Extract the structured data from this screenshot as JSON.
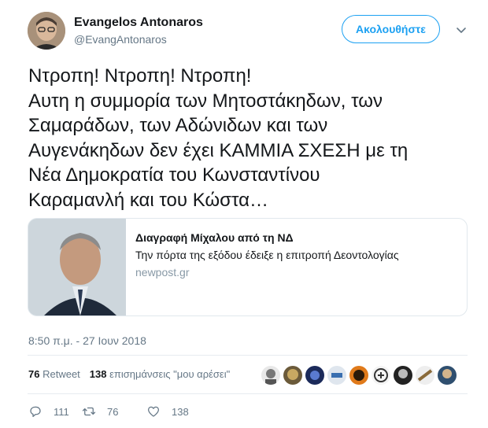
{
  "user": {
    "name": "Evangelos Antonaros",
    "handle": "@EvangAntonaros",
    "follow_label": "Ακολουθήστε"
  },
  "tweet": {
    "lines": [
      "Ντροπη! Ντροπη! Ντροπη!",
      "Αυτη η συμμορία των Μητοστάκηδων, των",
      "Σαμαράδων, των Αδώνιδων και των",
      "Αυγενάκηδων δεν έχει ΚΑΜΜΙΑ ΣΧΕΣΗ με τη",
      "Νέα Δημοκρατία του Κωνσταντίνου",
      "Καραμανλή και του Κώστα…"
    ],
    "timestamp": "8:50 π.μ. - 27 Ιουν 2018"
  },
  "card": {
    "title": "Διαγραφή Μίχαλου από τη ΝΔ",
    "description": "Την πόρτα της εξόδου έδειξε η επιτροπή Δεοντολογίας",
    "domain": "newpost.gr"
  },
  "stats": {
    "retweets_count": "76",
    "retweets_label": "Retweet",
    "likes_count": "138",
    "likes_label": "επισημάνσεις \"μου αρέσει\""
  },
  "actions": {
    "replies": "111",
    "retweets": "76",
    "likes": "138"
  },
  "icons": {
    "reply": "reply-icon",
    "retweet": "retweet-icon",
    "like": "heart-icon",
    "more": "chevron-down-icon"
  },
  "colors": {
    "accent": "#1da1f2",
    "secondary_text": "#657786",
    "domain_text": "#8899a6",
    "border": "#e1e8ed"
  }
}
